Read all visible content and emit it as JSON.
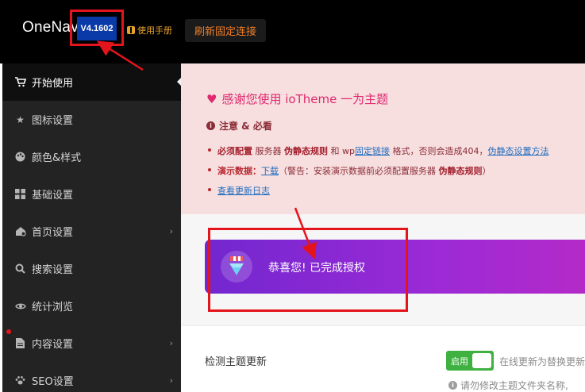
{
  "header": {
    "logo": "OneNav",
    "version": "V4.1602",
    "manual_label": "使用手册",
    "refresh_label": "刷新固定连接"
  },
  "sidebar": {
    "items": [
      {
        "label": "开始使用",
        "icon": "cart-icon"
      },
      {
        "label": "图标设置",
        "icon": "star-icon"
      },
      {
        "label": "颜色&样式",
        "icon": "palette-icon"
      },
      {
        "label": "基础设置",
        "icon": "grid-icon"
      },
      {
        "label": "首页设置",
        "icon": "home-gear-icon"
      },
      {
        "label": "搜索设置",
        "icon": "search-icon"
      },
      {
        "label": "统计浏览",
        "icon": "eye-icon"
      },
      {
        "label": "内容设置",
        "icon": "file-icon"
      },
      {
        "label": "SEO设置",
        "icon": "paw-icon"
      }
    ]
  },
  "notice": {
    "title": "感谢您使用 ioTheme 一为主题",
    "attention": "注意 & 必看",
    "note1": {
      "bold": "必须配置",
      "t1": " 服务器 ",
      "b2": "伪静态规则",
      "t2": " 和 wp",
      "link": "固定链接",
      "t3": " 格式，否则会造成404，",
      "link2": "伪静态设置方法"
    },
    "note2": {
      "bold": "演示数据：",
      "link": "下载",
      "t1": "（警告：安装演示数据前必须配置服务器 ",
      "b2": "伪静态规则",
      "t2": "）"
    },
    "note3": {
      "link": "查看更新日志"
    }
  },
  "license": {
    "text": "恭喜您! 已完成授权"
  },
  "update_panel": {
    "label": "检测主题更新",
    "toggle_label": "启用",
    "desc": "在线更新为替换更新",
    "warn": "请勿修改主题文件夹名称,"
  },
  "colors": {
    "accent_pink": "#e0296f",
    "license_gradient_start": "#7227cf",
    "toggle_green": "#3fb141",
    "annotation_red": "#e3141b"
  }
}
